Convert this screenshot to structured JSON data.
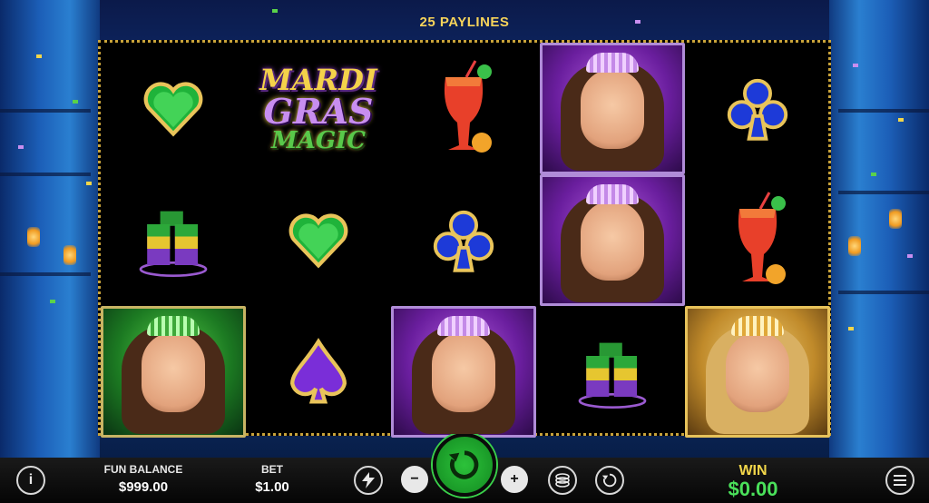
{
  "header": {
    "paylines_label": "25 PAYLINES"
  },
  "logo": {
    "line1": "MARDI",
    "line2": "GRAS",
    "line3": "MAGIC"
  },
  "symbols": {
    "green-heart": "green-heart-gem-icon",
    "blue-club": "blue-club-gem-icon",
    "purple-spade": "purple-spade-gem-icon",
    "cocktail": "hurricane-cocktail-icon",
    "shots": "mardi-gras-shots-icon",
    "purple-lady": "purple-masquerade-lady-icon",
    "green-lady": "green-masquerade-lady-icon",
    "gold-lady": "gold-masquerade-lady-icon"
  },
  "controls": {
    "info_icon": "info-icon",
    "balance_label": "FUN BALANCE",
    "balance_value": "$999.00",
    "bet_label": "BET",
    "bet_value": "$1.00",
    "turbo_icon": "lightning-icon",
    "minus": "−",
    "plus": "+",
    "spin_icon": "spin-arrow-icon",
    "coins_icon": "coin-stack-icon",
    "autoplay_icon": "autoplay-icon",
    "win_label": "WIN",
    "win_value": "$0.00",
    "menu_icon": "menu-icon"
  },
  "colors": {
    "accent_gold": "#f2d64a",
    "spin_green": "#1a9a28",
    "win_green": "#4ae05a"
  }
}
